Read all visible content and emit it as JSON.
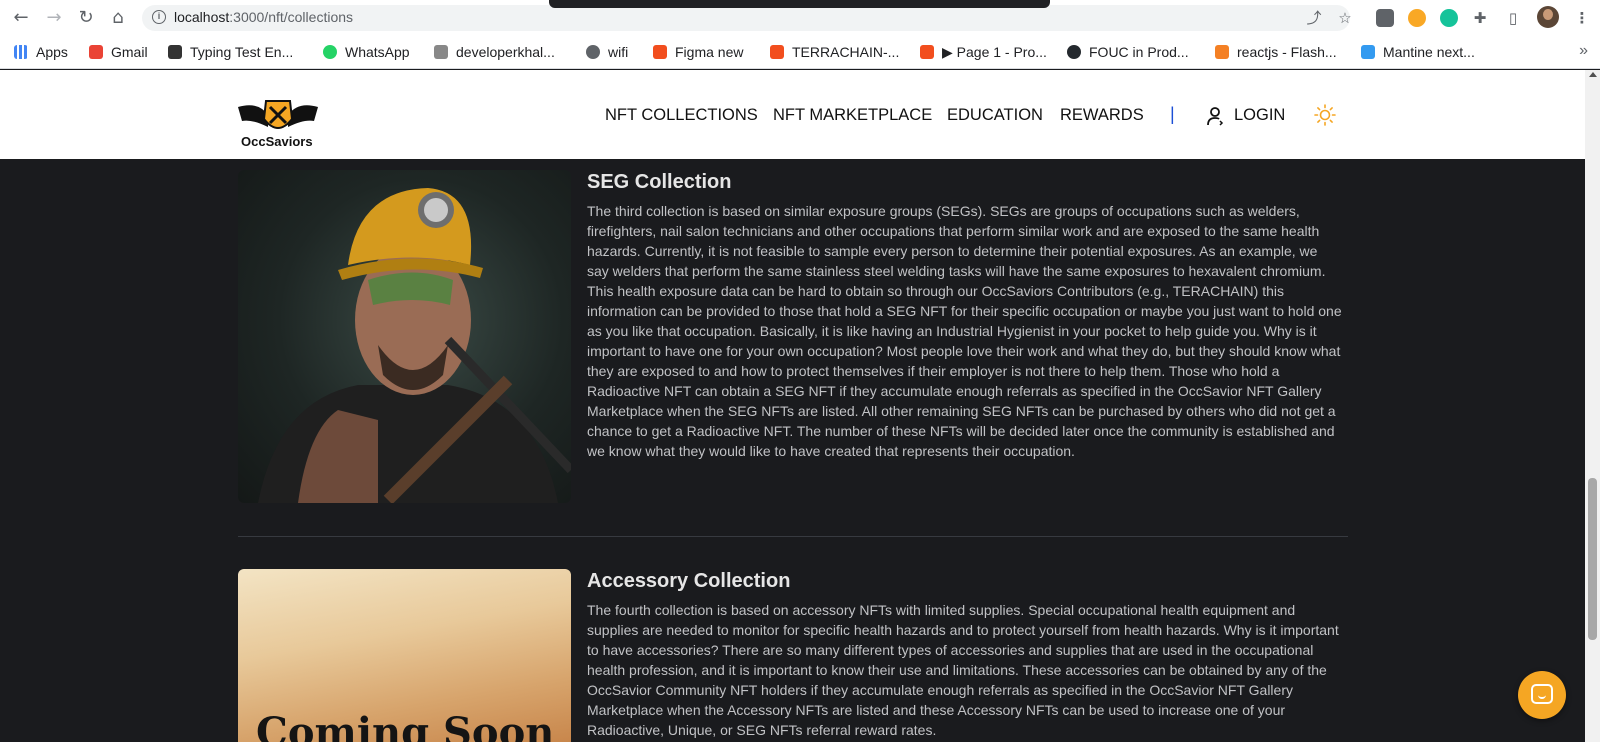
{
  "browser": {
    "url_host": "localhost",
    "url_path": ":3000/nft/collections",
    "bookmarks": [
      {
        "label": "Apps",
        "color": "#4285f4"
      },
      {
        "label": "Gmail",
        "color": "#ea4335"
      },
      {
        "label": "Typing Test En...",
        "color": "#333333"
      },
      {
        "label": "WhatsApp",
        "color": "#25d366"
      },
      {
        "label": "developerkhal...",
        "color": "#888888"
      },
      {
        "label": "wifi",
        "color": "#5f6368"
      },
      {
        "label": "Figma new",
        "color": "#f24e1e"
      },
      {
        "label": "TERRACHAIN-...",
        "color": "#f24e1e"
      },
      {
        "label": "▶ Page 1 - Pro...",
        "color": "#f24e1e"
      },
      {
        "label": "FOUC in Prod...",
        "color": "#24292e"
      },
      {
        "label": "reactjs - Flash...",
        "color": "#f48024"
      },
      {
        "label": "Mantine next...",
        "color": "#339af0"
      }
    ],
    "more_label": "»"
  },
  "header": {
    "logo_text": "OccSaviors",
    "nav": {
      "collections": "NFT COLLECTIONS",
      "marketplace": "NFT MARKETPLACE",
      "education": "EDUCATION",
      "rewards": "REWARDS",
      "separator": "|",
      "login": "LOGIN"
    }
  },
  "collections": [
    {
      "title": "SEG Collection",
      "description": "The third collection is based on similar exposure groups (SEGs). SEGs are groups of occupations such as welders, firefighters, nail salon technicians and other occupations that perform similar work and are exposed to the same health hazards. Currently, it is not feasible to sample every person to determine their potential exposures. As an example, we say welders that perform the same stainless steel welding tasks will have the same exposures to hexavalent chromium. This health exposure data can be hard to obtain so through our OccSaviors Contributors (e.g., TERACHAIN) this information can be provided to those that hold a SEG NFT for their specific occupation or maybe you just want to hold one as you like that occupation. Basically, it is like having an Industrial Hygienist in your pocket to help guide you. Why is it important to have one for your own occupation? Most people love their work and what they do, but they should know what they are exposed to and how to protect themselves if their employer is not there to help them. Those who hold a Radioactive NFT can obtain a SEG NFT if they accumulate enough referrals as specified in the OccSavior NFT Gallery Marketplace when the SEG NFTs are listed. All other remaining SEG NFTs can be purchased by others who did not get a chance to get a Radioactive NFT. The number of these NFTs will be decided later once the community is established and we know what they would like to have created that represents their occupation."
    },
    {
      "title": "Accessory Collection",
      "description": "The fourth collection is based on accessory NFTs with limited supplies. Special occupational health equipment and supplies are needed to monitor for specific health hazards and to protect yourself from health hazards. Why is it important to have accessories? There are so many different types of accessories and supplies that are used in the occupational health profession, and it is important to know their use and limitations. These accessories can be obtained by any of the OccSavior Community NFT holders if they accumulate enough referrals as specified in the OccSavior NFT Gallery Marketplace when the Accessory NFTs are listed and these Accessory NFTs can be used to increase one of your Radioactive, Unique, or SEG NFTs referral reward rates.",
      "image_text": "Coming Soon"
    }
  ],
  "colors": {
    "accent": "#f5a623",
    "background": "#1a1b1e",
    "nav_separator": "#1c4fd6"
  }
}
